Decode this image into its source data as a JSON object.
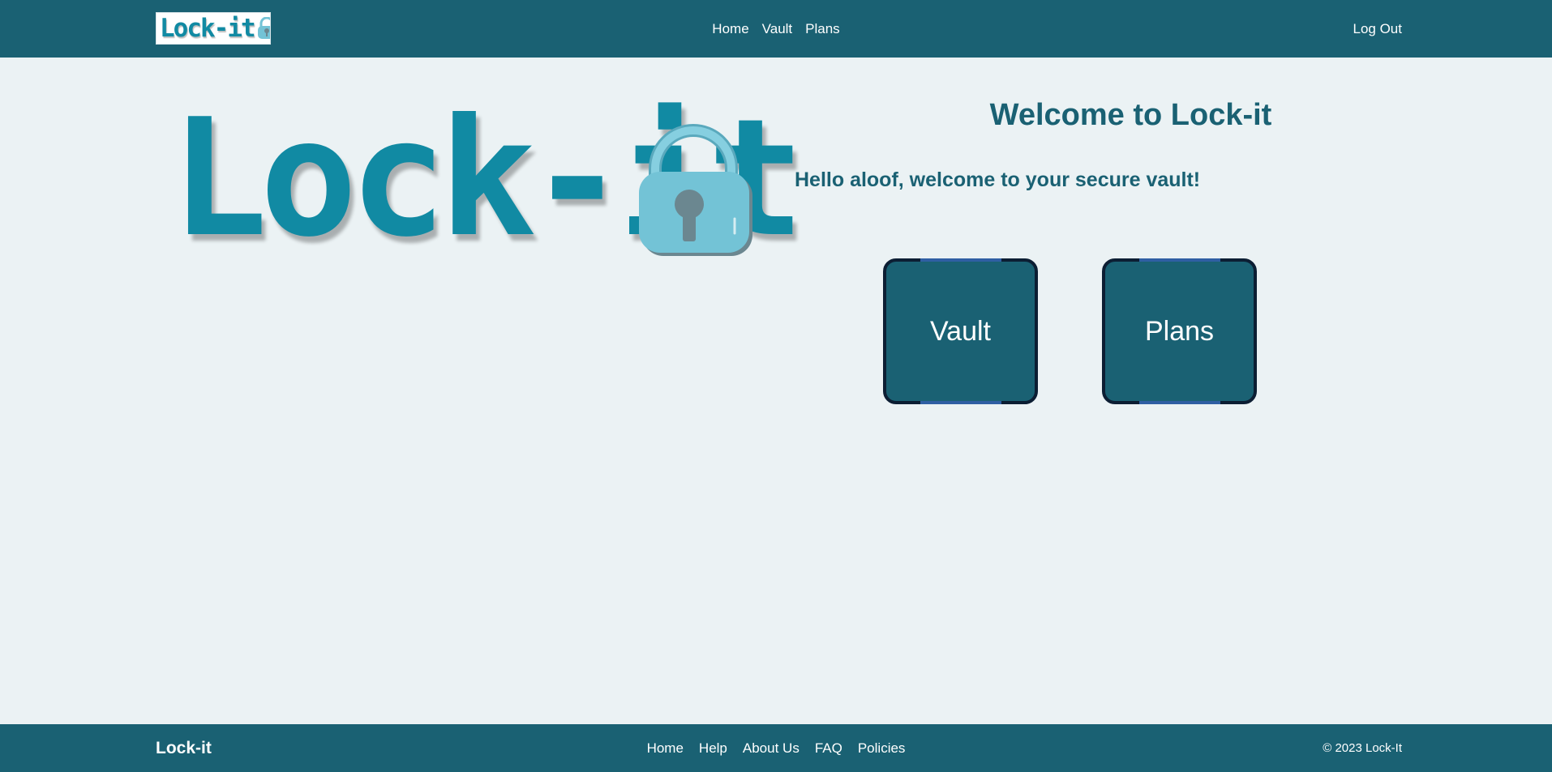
{
  "header": {
    "logo_text": "Lock-it",
    "nav": [
      {
        "label": "Home"
      },
      {
        "label": "Vault"
      },
      {
        "label": "Plans"
      }
    ],
    "logout_label": "Log Out"
  },
  "hero": {
    "logo_text": "Lock-it",
    "logo_icon": "padlock-icon"
  },
  "main": {
    "title": "Welcome to Lock-it",
    "greeting": "Hello aloof, welcome to your secure vault!",
    "tiles": [
      {
        "label": "Vault"
      },
      {
        "label": "Plans"
      }
    ]
  },
  "footer": {
    "brand": "Lock-it",
    "links": [
      {
        "label": "Home"
      },
      {
        "label": "Help"
      },
      {
        "label": "About Us"
      },
      {
        "label": "FAQ"
      },
      {
        "label": "Policies"
      }
    ],
    "copyright": "© 2023 Lock-It"
  },
  "colors": {
    "header_bg": "#1a6173",
    "page_bg": "#ebf2f4",
    "brand_teal": "#118aa3",
    "padlock": "#73c3d6",
    "tile_border": "#0c1e33",
    "tile_accent": "#2f5fa3"
  }
}
